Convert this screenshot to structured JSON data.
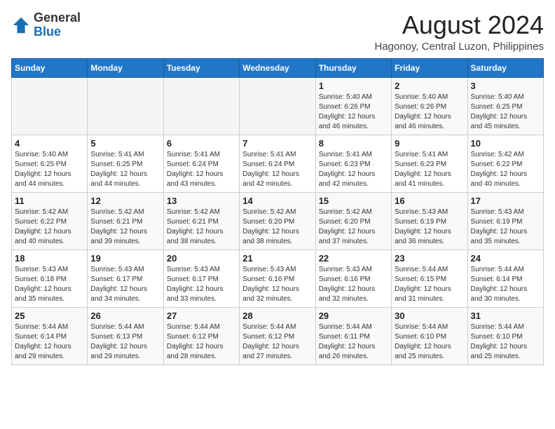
{
  "header": {
    "logo_general": "General",
    "logo_blue": "Blue",
    "main_title": "August 2024",
    "subtitle": "Hagonoy, Central Luzon, Philippines"
  },
  "calendar": {
    "days_of_week": [
      "Sunday",
      "Monday",
      "Tuesday",
      "Wednesday",
      "Thursday",
      "Friday",
      "Saturday"
    ],
    "weeks": [
      [
        {
          "day": "",
          "info": ""
        },
        {
          "day": "",
          "info": ""
        },
        {
          "day": "",
          "info": ""
        },
        {
          "day": "",
          "info": ""
        },
        {
          "day": "1",
          "info": "Sunrise: 5:40 AM\nSunset: 6:26 PM\nDaylight: 12 hours\nand 46 minutes."
        },
        {
          "day": "2",
          "info": "Sunrise: 5:40 AM\nSunset: 6:26 PM\nDaylight: 12 hours\nand 46 minutes."
        },
        {
          "day": "3",
          "info": "Sunrise: 5:40 AM\nSunset: 6:25 PM\nDaylight: 12 hours\nand 45 minutes."
        }
      ],
      [
        {
          "day": "4",
          "info": "Sunrise: 5:40 AM\nSunset: 6:25 PM\nDaylight: 12 hours\nand 44 minutes."
        },
        {
          "day": "5",
          "info": "Sunrise: 5:41 AM\nSunset: 6:25 PM\nDaylight: 12 hours\nand 44 minutes."
        },
        {
          "day": "6",
          "info": "Sunrise: 5:41 AM\nSunset: 6:24 PM\nDaylight: 12 hours\nand 43 minutes."
        },
        {
          "day": "7",
          "info": "Sunrise: 5:41 AM\nSunset: 6:24 PM\nDaylight: 12 hours\nand 42 minutes."
        },
        {
          "day": "8",
          "info": "Sunrise: 5:41 AM\nSunset: 6:23 PM\nDaylight: 12 hours\nand 42 minutes."
        },
        {
          "day": "9",
          "info": "Sunrise: 5:41 AM\nSunset: 6:23 PM\nDaylight: 12 hours\nand 41 minutes."
        },
        {
          "day": "10",
          "info": "Sunrise: 5:42 AM\nSunset: 6:22 PM\nDaylight: 12 hours\nand 40 minutes."
        }
      ],
      [
        {
          "day": "11",
          "info": "Sunrise: 5:42 AM\nSunset: 6:22 PM\nDaylight: 12 hours\nand 40 minutes."
        },
        {
          "day": "12",
          "info": "Sunrise: 5:42 AM\nSunset: 6:21 PM\nDaylight: 12 hours\nand 39 minutes."
        },
        {
          "day": "13",
          "info": "Sunrise: 5:42 AM\nSunset: 6:21 PM\nDaylight: 12 hours\nand 38 minutes."
        },
        {
          "day": "14",
          "info": "Sunrise: 5:42 AM\nSunset: 6:20 PM\nDaylight: 12 hours\nand 38 minutes."
        },
        {
          "day": "15",
          "info": "Sunrise: 5:42 AM\nSunset: 6:20 PM\nDaylight: 12 hours\nand 37 minutes."
        },
        {
          "day": "16",
          "info": "Sunrise: 5:43 AM\nSunset: 6:19 PM\nDaylight: 12 hours\nand 36 minutes."
        },
        {
          "day": "17",
          "info": "Sunrise: 5:43 AM\nSunset: 6:19 PM\nDaylight: 12 hours\nand 35 minutes."
        }
      ],
      [
        {
          "day": "18",
          "info": "Sunrise: 5:43 AM\nSunset: 6:18 PM\nDaylight: 12 hours\nand 35 minutes."
        },
        {
          "day": "19",
          "info": "Sunrise: 5:43 AM\nSunset: 6:17 PM\nDaylight: 12 hours\nand 34 minutes."
        },
        {
          "day": "20",
          "info": "Sunrise: 5:43 AM\nSunset: 6:17 PM\nDaylight: 12 hours\nand 33 minutes."
        },
        {
          "day": "21",
          "info": "Sunrise: 5:43 AM\nSunset: 6:16 PM\nDaylight: 12 hours\nand 32 minutes."
        },
        {
          "day": "22",
          "info": "Sunrise: 5:43 AM\nSunset: 6:16 PM\nDaylight: 12 hours\nand 32 minutes."
        },
        {
          "day": "23",
          "info": "Sunrise: 5:44 AM\nSunset: 6:15 PM\nDaylight: 12 hours\nand 31 minutes."
        },
        {
          "day": "24",
          "info": "Sunrise: 5:44 AM\nSunset: 6:14 PM\nDaylight: 12 hours\nand 30 minutes."
        }
      ],
      [
        {
          "day": "25",
          "info": "Sunrise: 5:44 AM\nSunset: 6:14 PM\nDaylight: 12 hours\nand 29 minutes."
        },
        {
          "day": "26",
          "info": "Sunrise: 5:44 AM\nSunset: 6:13 PM\nDaylight: 12 hours\nand 29 minutes."
        },
        {
          "day": "27",
          "info": "Sunrise: 5:44 AM\nSunset: 6:12 PM\nDaylight: 12 hours\nand 28 minutes."
        },
        {
          "day": "28",
          "info": "Sunrise: 5:44 AM\nSunset: 6:12 PM\nDaylight: 12 hours\nand 27 minutes."
        },
        {
          "day": "29",
          "info": "Sunrise: 5:44 AM\nSunset: 6:11 PM\nDaylight: 12 hours\nand 26 minutes."
        },
        {
          "day": "30",
          "info": "Sunrise: 5:44 AM\nSunset: 6:10 PM\nDaylight: 12 hours\nand 25 minutes."
        },
        {
          "day": "31",
          "info": "Sunrise: 5:44 AM\nSunset: 6:10 PM\nDaylight: 12 hours\nand 25 minutes."
        }
      ]
    ]
  }
}
